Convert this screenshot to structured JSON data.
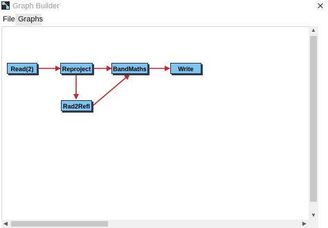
{
  "window": {
    "title": "Graph Builder",
    "close_glyph": "✕"
  },
  "menu": {
    "items": [
      "File",
      "Graphs"
    ]
  },
  "graph": {
    "nodes": [
      {
        "id": "read",
        "label": "Read(2)"
      },
      {
        "id": "reproject",
        "label": "Reproject"
      },
      {
        "id": "bandmaths",
        "label": "BandMaths"
      },
      {
        "id": "write",
        "label": "Write"
      },
      {
        "id": "rad2refl",
        "label": "Rad2Refl"
      }
    ],
    "edges": [
      {
        "from": "read",
        "to": "reproject"
      },
      {
        "from": "reproject",
        "to": "bandmaths"
      },
      {
        "from": "bandmaths",
        "to": "write"
      },
      {
        "from": "reproject",
        "to": "rad2refl"
      },
      {
        "from": "rad2refl",
        "to": "bandmaths"
      }
    ],
    "node_color": "#7fc3ee",
    "node_border_color": "#1d3a66",
    "edge_color": "#c8262b"
  },
  "icons": {
    "app": "graph-builder-icon",
    "close": "close-icon",
    "scroll_up": "scroll-up-icon",
    "scroll_down": "scroll-down-icon",
    "scroll_left": "scroll-left-icon",
    "scroll_right": "scroll-right-icon"
  }
}
